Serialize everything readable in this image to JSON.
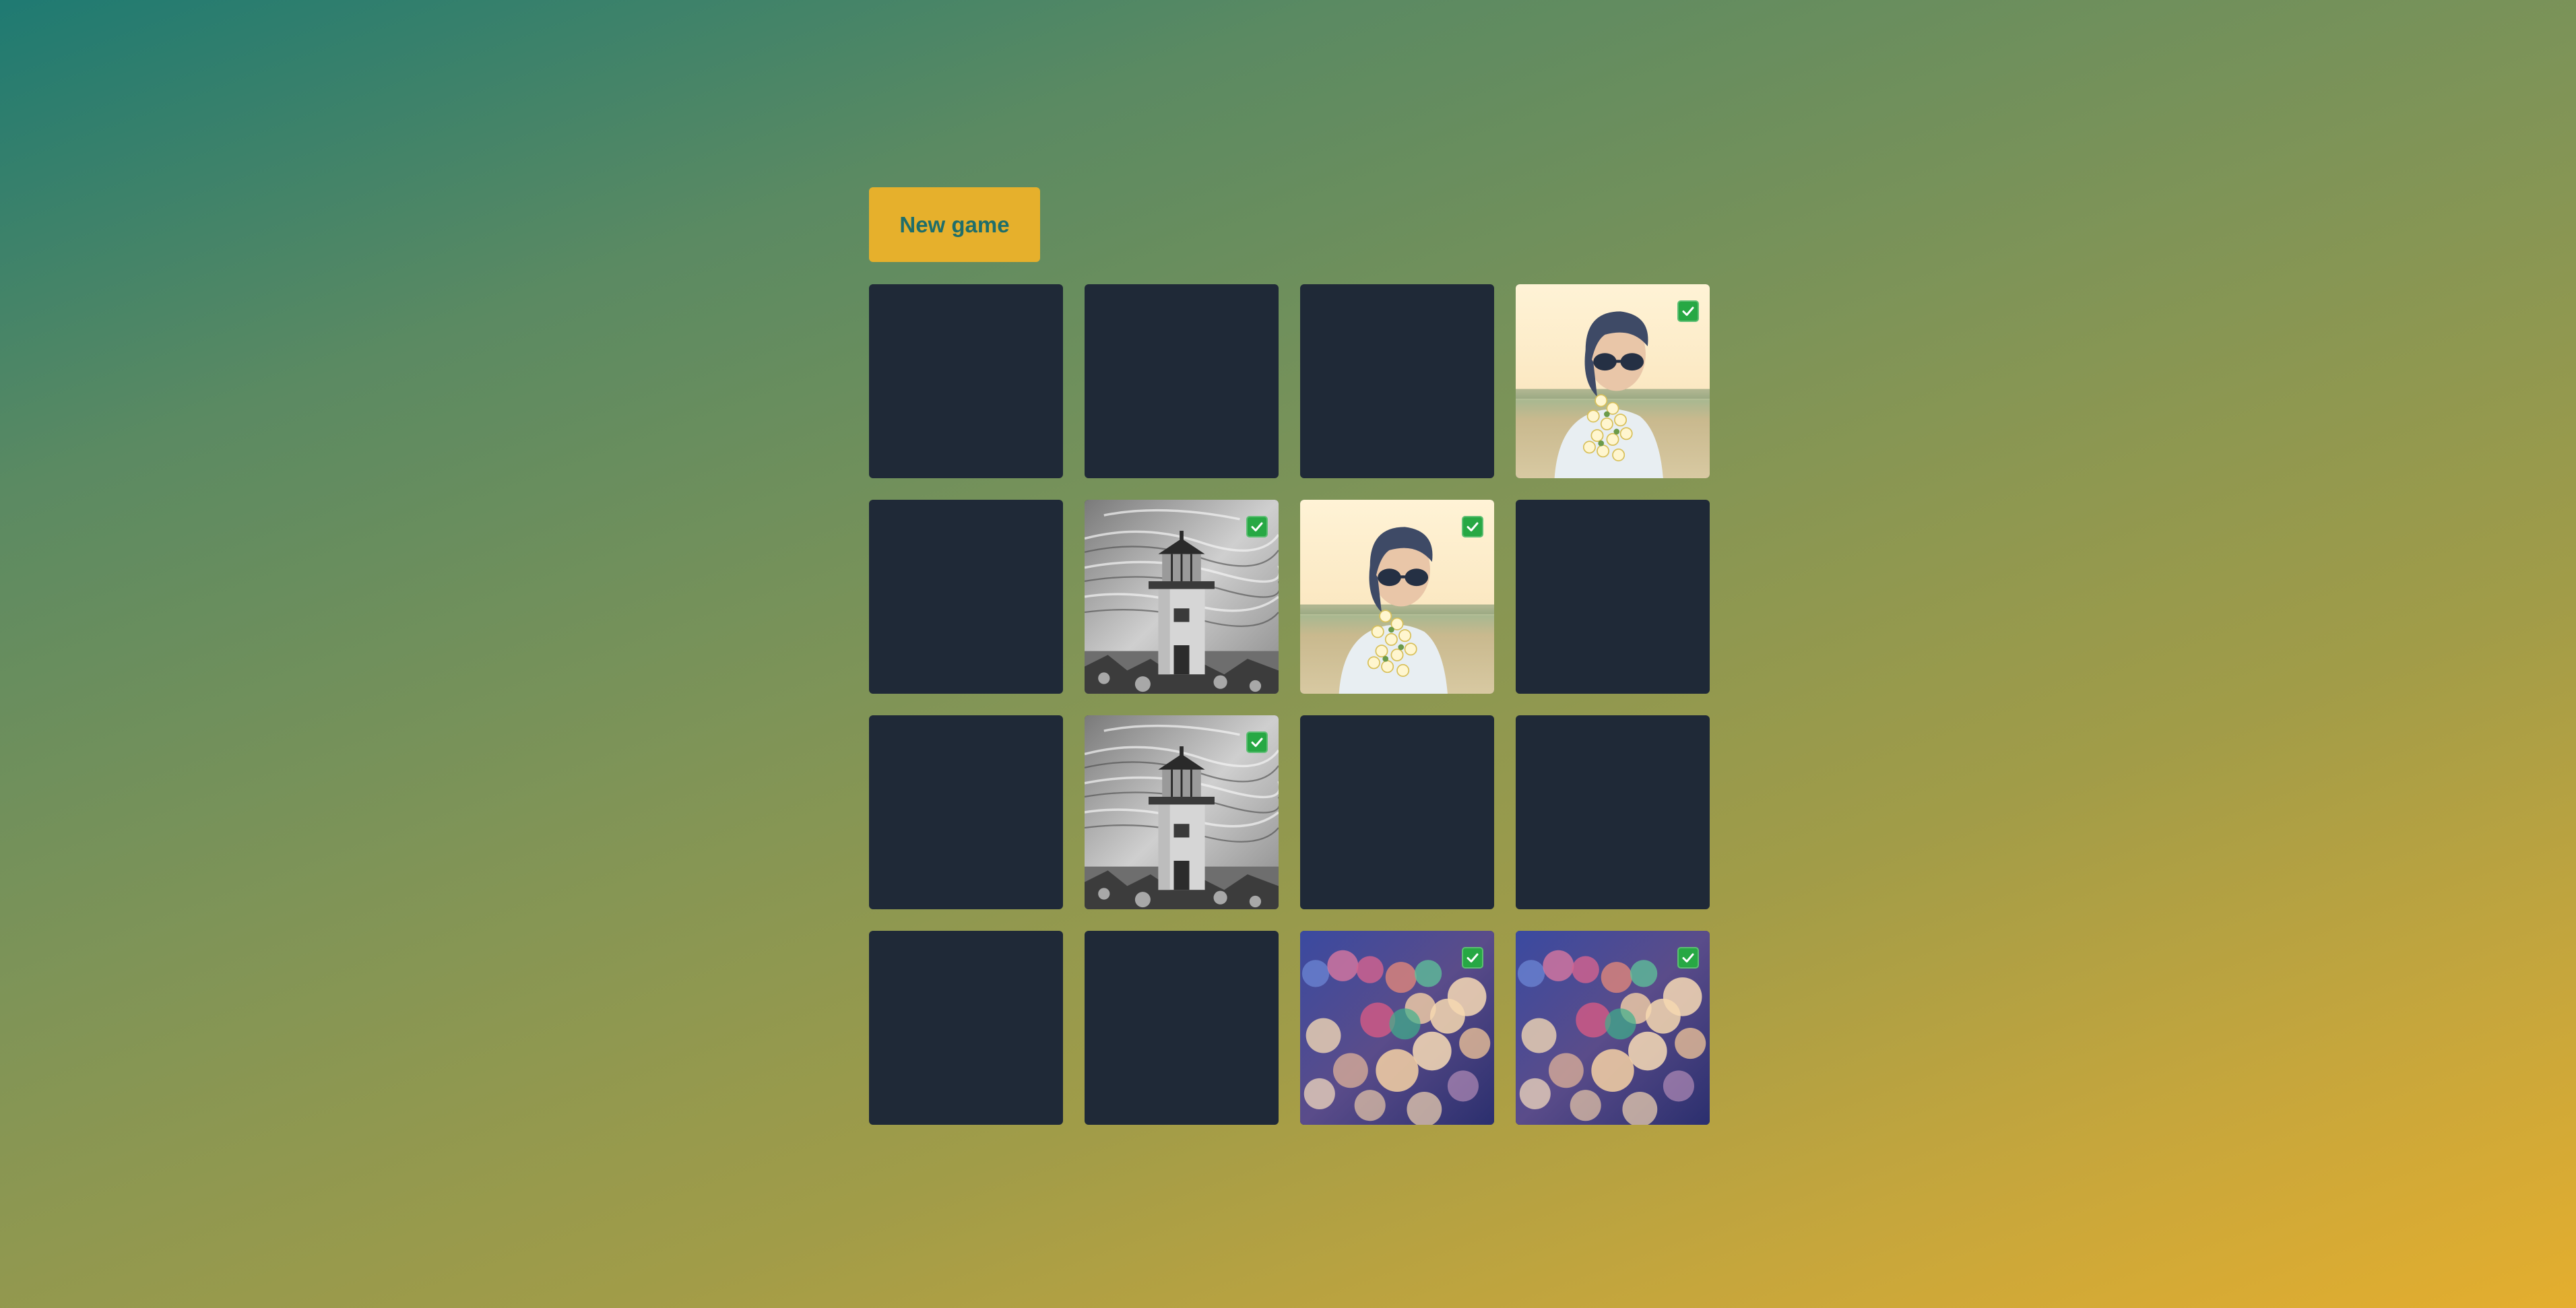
{
  "toolbar": {
    "new_game_label": "New game"
  },
  "board": {
    "columns": 4,
    "rows": 4,
    "cards": [
      {
        "image": "hidden",
        "revealed": false,
        "matched": false
      },
      {
        "image": "hidden",
        "revealed": false,
        "matched": false
      },
      {
        "image": "hidden",
        "revealed": false,
        "matched": false
      },
      {
        "image": "girl-with-flowers",
        "revealed": true,
        "matched": true
      },
      {
        "image": "hidden",
        "revealed": false,
        "matched": false
      },
      {
        "image": "lighthouse",
        "revealed": true,
        "matched": true
      },
      {
        "image": "girl-with-flowers",
        "revealed": true,
        "matched": true
      },
      {
        "image": "hidden",
        "revealed": false,
        "matched": false
      },
      {
        "image": "hidden",
        "revealed": false,
        "matched": false
      },
      {
        "image": "lighthouse",
        "revealed": true,
        "matched": true
      },
      {
        "image": "hidden",
        "revealed": false,
        "matched": false
      },
      {
        "image": "hidden",
        "revealed": false,
        "matched": false
      },
      {
        "image": "hidden",
        "revealed": false,
        "matched": false
      },
      {
        "image": "hidden",
        "revealed": false,
        "matched": false
      },
      {
        "image": "bokeh-lights",
        "revealed": true,
        "matched": true
      },
      {
        "image": "bokeh-lights",
        "revealed": true,
        "matched": true
      }
    ]
  },
  "colors": {
    "card_back": "#1f2937",
    "button_bg": "#e6b02c",
    "button_text": "#1f6e6a",
    "matched_badge": "#27a844"
  },
  "icons": {
    "matched": "check-mark-icon"
  }
}
